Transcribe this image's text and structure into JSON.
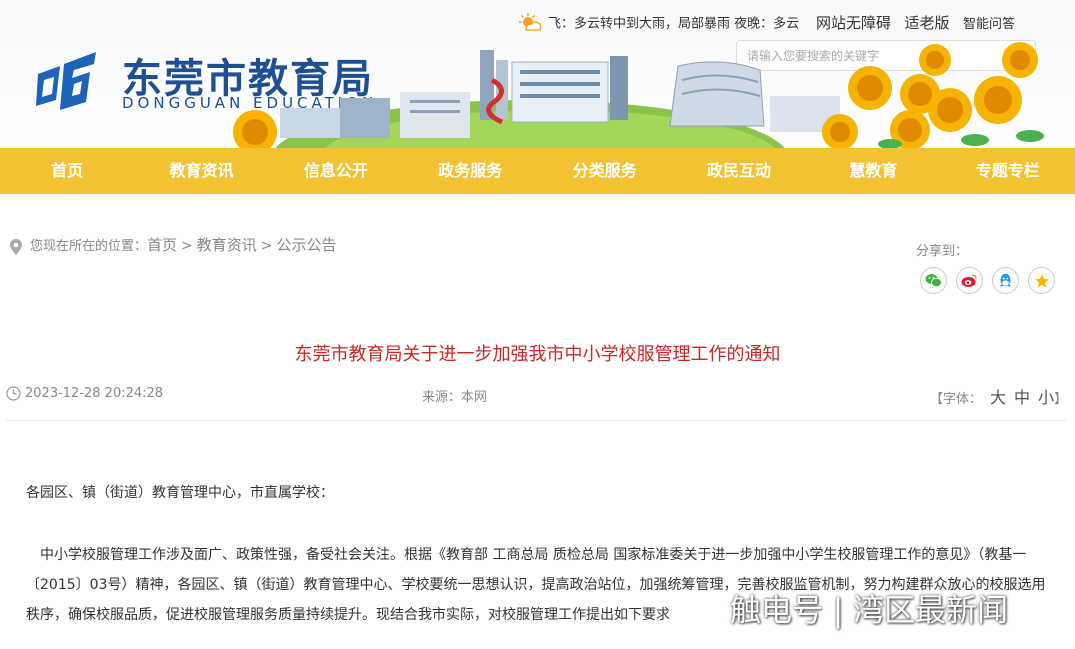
{
  "header": {
    "logo_cn": "东莞市教育局",
    "logo_en": "DONGGUAN EDUCATION",
    "weather_text": "飞：多云转中到大雨，局部暴雨 夜晚：多云",
    "links": [
      "网站无障碍",
      "适老版",
      "智能问答"
    ],
    "search_placeholder": "请输入您要搜索的关键字"
  },
  "nav": [
    "首页",
    "教育资讯",
    "信息公开",
    "政务服务",
    "分类服务",
    "政民互动",
    "慧教育",
    "专题专栏"
  ],
  "breadcrumb": {
    "prefix": "您现在所在的位置：",
    "items": [
      "首页",
      "教育资讯",
      "公示公告"
    ],
    "separator": ">"
  },
  "share": {
    "label": "分享到：",
    "icons": [
      "wechat-icon",
      "weibo-icon",
      "qq-icon",
      "qzone-icon"
    ]
  },
  "article": {
    "title": "东莞市教育局关于进一步加强我市中小学校服管理工作的通知",
    "datetime": "2023-12-28 20:24:28",
    "source": "来源：本网",
    "font_label": "【字体：",
    "font_sizes": [
      "大",
      "中",
      "小"
    ],
    "font_close": "】",
    "greeting": "各园区、镇（街道）教育管理中心，市直属学校：",
    "paragraph": "中小学校服管理工作涉及面广、政策性强，备受社会关注。根据《教育部 工商总局 质检总局 国家标准委关于进一步加强中小学生校服管理工作的意见》（教基一〔2015〕03号）精神，各园区、镇（街道）教育管理中心、学校要统一思想认识，提高政治站位，加强统筹管理，完善校服监管机制，努力构建群众放心的校服选用秩序，确保校服品质，促进校服管理服务质量持续提升。现结合我市实际，对校服管理工作提出如下要求"
  },
  "watermark": "触电号 | 湾区最新闻",
  "colors": {
    "nav_bg": "#f3c233",
    "title_red": "#c62828",
    "brand_blue": "#1d4f91"
  }
}
